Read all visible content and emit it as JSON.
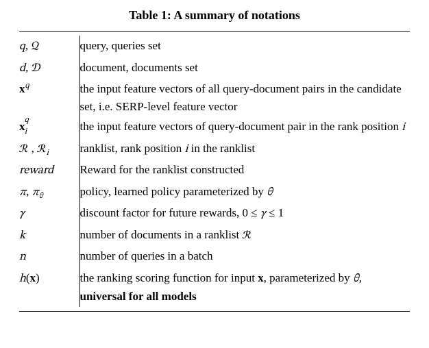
{
  "caption": "Table 1: A summary of notations",
  "rows": [
    {
      "symbol_html": "<span class=\"math\">q</span>, <span class=\"cal\">𝒬</span>",
      "symbol_text": "q, Q",
      "desc": "query, queries set"
    },
    {
      "symbol_html": "<span class=\"math\">d</span>, <span class=\"cal\">𝒟</span>",
      "symbol_text": "d, D",
      "desc": "document, documents set"
    },
    {
      "symbol_html": "<span class=\"bold\">x</span><span class=\"sup\"><span class=\"math\">q</span></span>",
      "symbol_text": "x^q",
      "desc": "the input feature vectors of all query-document pairs in the candidate set, i.e. SERP-level feature vector"
    },
    {
      "symbol_html": "<span class=\"subscript-stack\"><span class=\"base bold\">x</span><span class=\"sup2\"><span class=\"math\">q</span></span><span class=\"sub2\"><span class=\"math\">i</span></span></span>",
      "symbol_text": "x_i^q",
      "desc_html": "the input feature vectors of query-document pair in the rank position <span class=\"math\">i</span>",
      "desc": "the input feature vectors of query-document pair in the rank position i"
    },
    {
      "symbol_html": "<span class=\"cal\">ℛ</span> , <span class=\"cal\">ℛ</span><span class=\"sub\"><span class=\"math\">i</span></span>",
      "symbol_text": "R, R_i",
      "desc_html": "ranklist, rank position <span class=\"math\">i</span> in the ranklist",
      "desc": "ranklist, rank position i in the ranklist"
    },
    {
      "symbol_html": "<span class=\"math\">reward</span>",
      "symbol_text": "reward",
      "desc": "Reward for the ranklist constructed"
    },
    {
      "symbol_html": "<span class=\"math\">π</span>, <span class=\"math\">π</span><span class=\"sub\"><span class=\"math\">θ</span></span>",
      "symbol_text": "π, π_θ",
      "desc_html": "policy, learned policy parameterized by <span class=\"math\">θ</span>",
      "desc": "policy, learned policy parameterized by θ"
    },
    {
      "symbol_html": "<span class=\"math\">γ</span>",
      "symbol_text": "γ",
      "desc_html": "discount factor for future rewards, <span>0 ≤ <span class=\"math\">γ</span> ≤ 1</span>",
      "desc": "discount factor for future rewards, 0 ≤ γ ≤ 1"
    },
    {
      "symbol_html": "<span class=\"math\">k</span>",
      "symbol_text": "k",
      "desc_html": "number of documents in a ranklist <span class=\"cal\">ℛ</span>",
      "desc": "number of documents in a ranklist R"
    },
    {
      "symbol_html": "<span class=\"math\">n</span>",
      "symbol_text": "n",
      "desc": "number of queries in a batch"
    },
    {
      "symbol_html": "<span class=\"math\">h</span>(<span class=\"bold\">x</span>)",
      "symbol_text": "h(x)",
      "desc_html": "the ranking scoring function for input <span class=\"bold\">x</span>, parameterized by <span class=\"math\">θ</span>, <span class=\"bold\">universal for all models</span>",
      "desc": "the ranking scoring function for input x, parameterized by θ, universal for all models"
    }
  ]
}
